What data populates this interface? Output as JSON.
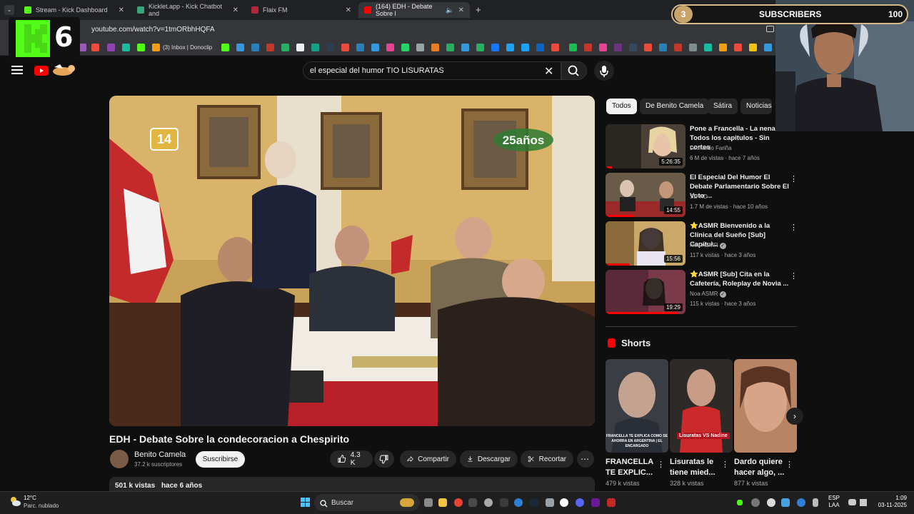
{
  "browser": {
    "tabs": [
      {
        "title": "Stream - Kick Dashboard",
        "active": false
      },
      {
        "title": "Kicklet.app - Kick Chatbot and",
        "active": false
      },
      {
        "title": "Flaix FM",
        "active": false
      },
      {
        "title": "(164) EDH - Debate Sobre l",
        "active": true
      }
    ],
    "new_tab": "+",
    "url": "youtube.com/watch?v=1tmORbhHQFA",
    "bookmark_label": "(3) Inbox | Donoclip"
  },
  "overlay": {
    "kick_number": "6",
    "subscribers": {
      "count": "3",
      "label": "SUBSCRIBERS",
      "goal": "100",
      "progress": 0.03
    }
  },
  "search": {
    "query": "el especial del humor TIO LISURATAS"
  },
  "video": {
    "title": "EDH - Debate Sobre la condecoracion a Chespirito",
    "channel": "Benito Camela",
    "subscribers": "37.2 k suscriptores",
    "subscribe_label": "Suscribirse",
    "likes": "4.3 K",
    "share_label": "Compartir",
    "download_label": "Descargar",
    "clip_label": "Recortar",
    "views": "501 k vistas",
    "age": "hace 6 años",
    "overlay_channel": "14",
    "overlay_badge": "25años"
  },
  "chips": [
    "Todos",
    "De Benito Camela",
    "Sátira",
    "Noticias"
  ],
  "recommendations": [
    {
      "title": "Pone a Francella - La nena - Todos los capitulos - Sin cortes",
      "channel": "Leonardo Fariña",
      "views": "6 M de vistas",
      "age": "hace 7 años",
      "duration": "5:26:35",
      "verified": false,
      "progress": 0.08
    },
    {
      "title": "El Especial Del Humor El Debate Parlamentario Sobre El Voto ...",
      "channel": "SD HD",
      "views": "1.7 M de vistas",
      "age": "hace 10 años",
      "duration": "14:55",
      "verified": false,
      "progress": 0.35
    },
    {
      "title": "⭐ASMR Bienvenido a la Clínica del Sueño [Sub] Capítul...",
      "channel": "Noa ASMR",
      "views": "117 k vistas",
      "age": "hace 3 años",
      "duration": "15:56",
      "verified": true,
      "progress": 0.3
    },
    {
      "title": "⭐ASMR [Sub] Cita en la Cafetería, Roleplay de Novia ...",
      "channel": "Noa ASMR",
      "views": "115 k vistas",
      "age": "hace 3 años",
      "duration": "19:29",
      "verified": true,
      "progress": 0.9
    }
  ],
  "shorts": {
    "title": "Shorts",
    "items": [
      {
        "title": "FRANCELLA TE EXPLIC...",
        "views": "479 k vistas",
        "caption": "FRANCELLA TE EXPLICA COMO SE AHORRA EN ARGENTINA | EL ENCARGADO"
      },
      {
        "title": "Lisuratas le tiene mied...",
        "views": "328 k vistas",
        "caption": "Lisuratas VS Nadine"
      },
      {
        "title": "Dardo quiere hacer algo, ...",
        "views": "877 k vistas",
        "caption": ""
      }
    ]
  },
  "taskbar": {
    "temperature": "12°C",
    "weather": "Parc. nublado",
    "search_label": "Buscar",
    "language": "ESP",
    "keyboard": "LAA",
    "time": "1:09",
    "date": "03-11-2025"
  }
}
